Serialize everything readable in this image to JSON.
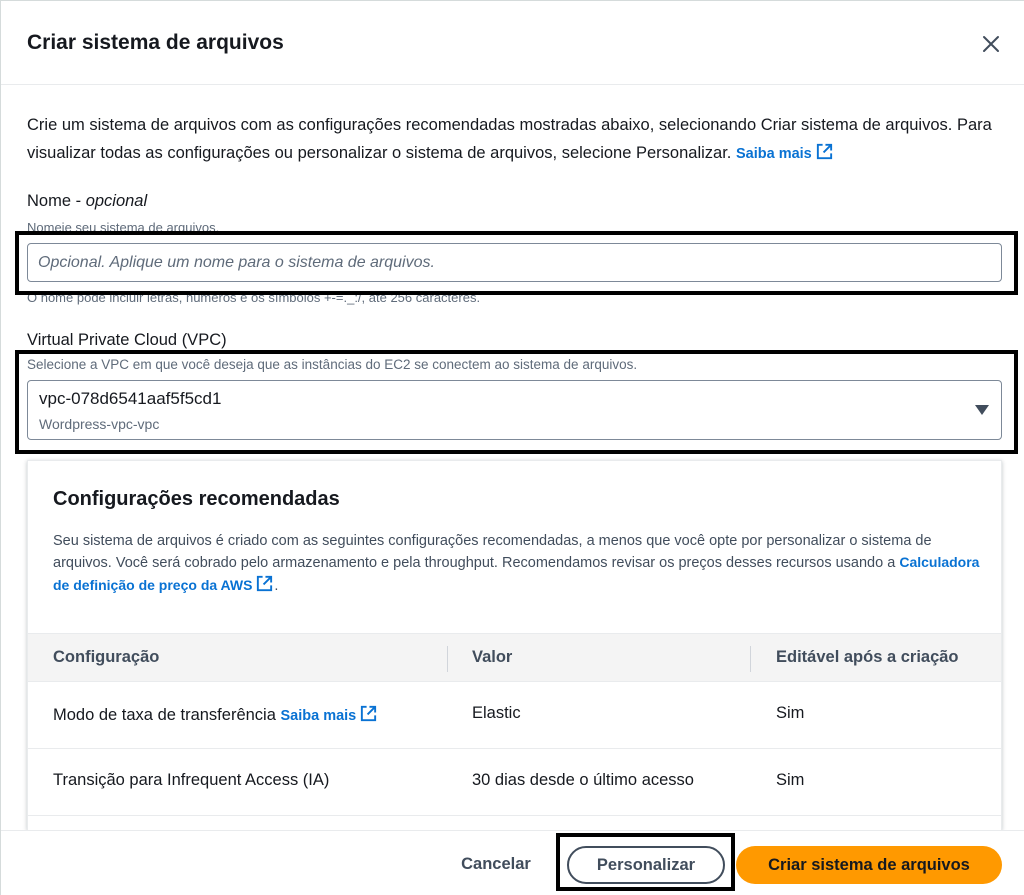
{
  "modal": {
    "title": "Criar sistema de arquivos",
    "intro_text": "Crie um sistema de arquivos com as configurações recomendadas mostradas abaixo, selecionando Criar sistema de arquivos. Para visualizar todas as configurações ou personalizar o sistema de arquivos, selecione Personalizar.",
    "learn_more": "Saiba mais"
  },
  "name_field": {
    "label": "Nome",
    "label_optional": "opcional",
    "description": "Nomeie seu sistema de arquivos.",
    "placeholder": "Opcional. Aplique um nome para o sistema de arquivos.",
    "value": "",
    "constraint": "O nome pode incluir letras, números e os símbolos +-=._:/, até 256 caracteres."
  },
  "vpc_field": {
    "label": "Virtual Private Cloud (VPC)",
    "description": "Selecione a VPC em que você deseja que as instâncias do EC2 se conectem ao sistema de arquivos.",
    "selected_id": "vpc-078d6541aaf5f5cd1",
    "selected_name": "Wordpress-vpc-vpc"
  },
  "recommended": {
    "title": "Configurações recomendadas",
    "description": "Seu sistema de arquivos é criado com as seguintes configurações recomendadas, a menos que você opte por personalizar o sistema de arquivos. Você será cobrado pelo armazenamento e pela throughput. Recomendamos revisar os preços desses recursos usando a",
    "calculator_link": "Calculadora de definição de preço da AWS",
    "period": ".",
    "columns": [
      "Configuração",
      "Valor",
      "Editável após a criação"
    ],
    "rows": [
      {
        "config": "Modo de taxa de transferência",
        "learn_more": "Saiba mais",
        "value": "Elastic",
        "editable": "Sim"
      },
      {
        "config": "Transição para Infrequent Access (IA)",
        "value": "30 dias desde o último acesso",
        "editable": "Sim"
      }
    ]
  },
  "footer": {
    "cancel": "Cancelar",
    "customize": "Personalizar",
    "create": "Criar sistema de arquivos"
  },
  "colors": {
    "link": "#0972d3",
    "primary_button": "#ff9900",
    "highlight_border": "#000000"
  },
  "icons": [
    "close-icon",
    "external-link-icon",
    "caret-down-icon"
  ]
}
